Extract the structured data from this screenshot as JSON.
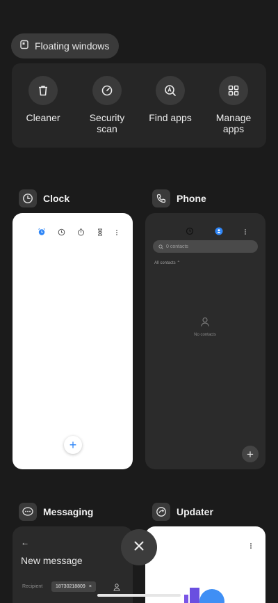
{
  "floating_windows": {
    "label": "Floating windows",
    "icon": "floating-window-icon"
  },
  "quick_actions": [
    {
      "label": "Cleaner",
      "icon": "trash-icon"
    },
    {
      "label": "Security\nscan",
      "icon": "shield-scan-icon"
    },
    {
      "label": "Find apps",
      "icon": "find-apps-icon"
    },
    {
      "label": "Manage\napps",
      "icon": "grid-icon"
    }
  ],
  "apps": {
    "clock": {
      "name": "Clock",
      "icon": "clock-icon"
    },
    "phone": {
      "name": "Phone",
      "icon": "phone-icon",
      "search_placeholder": "0 contacts",
      "filter": "All contacts",
      "empty_text": "No contacts"
    },
    "messaging": {
      "name": "Messaging",
      "icon": "chat-icon",
      "title": "New message",
      "recipient_label": "Recipient",
      "recipient_value": "18730218809"
    },
    "updater": {
      "name": "Updater",
      "icon": "updater-icon"
    }
  },
  "colors": {
    "background": "#1b1b1b",
    "panel": "#262626",
    "accent_blue": "#2f86f7"
  }
}
